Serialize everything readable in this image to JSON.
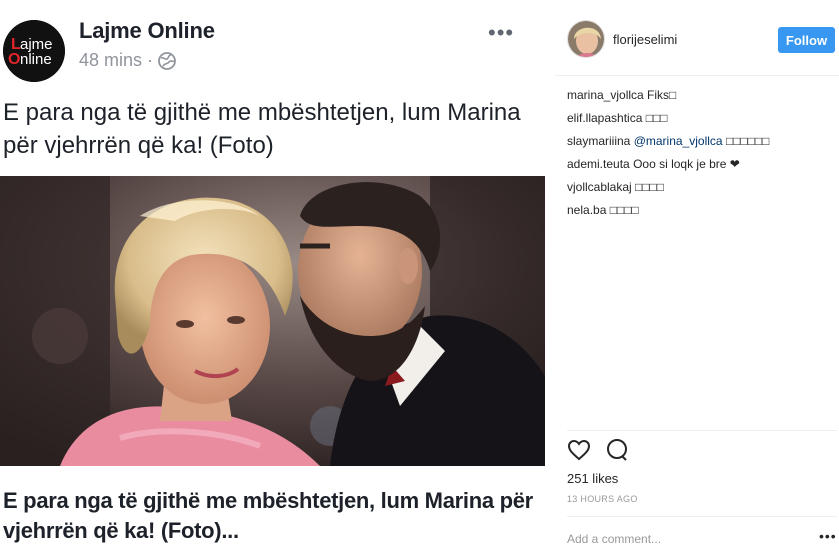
{
  "facebook_post": {
    "page_name": "Lajme Online",
    "avatar_logo_line1": "ajme",
    "avatar_logo_line2": "nline",
    "avatar_logo_initial1": "L",
    "avatar_logo_initial2": "O",
    "timestamp": "48 mins",
    "separator": "·",
    "more_label": "•••",
    "caption": "E para nga të gjithë me mbështetjen, lum Marina për vjehrrën që ka! (Foto)",
    "link_title": "E para nga të gjithë me mbështetjen, lum Marina për vjehrrën që ka! (Foto)..."
  },
  "instagram": {
    "username": "florijeselimi",
    "follow_label": "Follow",
    "comments": [
      {
        "user": "marina_vjollca",
        "text": "Fiks□",
        "mention": ""
      },
      {
        "user": "elif.llapashtica",
        "text": "□□□",
        "mention": ""
      },
      {
        "user": "slaymariiina",
        "mention": "@marina_vjollca",
        "text": "□□□□□□"
      },
      {
        "user": "ademi.teuta",
        "text": "Ooo si loqk je bre ❤",
        "mention": ""
      },
      {
        "user": "vjollcablakaj",
        "text": "□□□□",
        "mention": ""
      },
      {
        "user": "nela.ba",
        "text": "□□□□",
        "mention": ""
      }
    ],
    "likes": "251 likes",
    "time": "13 HOURS AGO",
    "add_comment_placeholder": "Add a comment...",
    "comment_more": "•••"
  },
  "colors": {
    "follow_button": "#3897f0",
    "text": "#1d2129",
    "meta": "#90949c"
  },
  "icons": [
    "globe-icon",
    "more-icon",
    "heart-icon",
    "comment-icon"
  ]
}
